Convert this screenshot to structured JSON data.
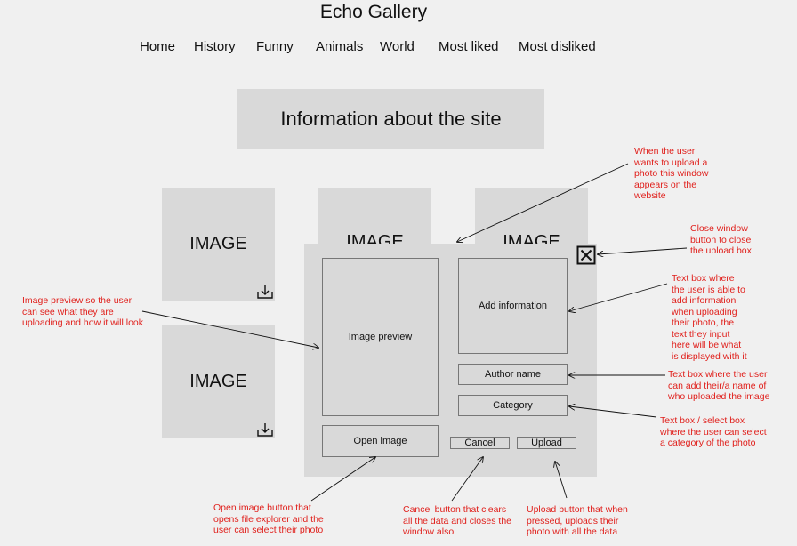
{
  "site": {
    "title": "Echo Gallery"
  },
  "nav": {
    "items": [
      "Home",
      "History",
      "Funny",
      "Animals",
      "World",
      "Most liked",
      "Most disliked"
    ]
  },
  "info": {
    "text": "Information about the site"
  },
  "tiles": {
    "label": "IMAGE"
  },
  "modal": {
    "image_preview": "Image preview",
    "open_image": "Open image",
    "add_information": "Add information",
    "author_name": "Author name",
    "category": "Category",
    "cancel": "Cancel",
    "upload": "Upload"
  },
  "annotations": {
    "window_appears": [
      "When the user",
      "wants to upload a",
      "photo this window",
      "appears on the",
      "website"
    ],
    "close_window": [
      "Close window",
      "button to close",
      "the upload box"
    ],
    "add_info": [
      "Text box where",
      "the user is able to",
      "add information",
      "when uploading",
      "their photo, the",
      "text they input",
      "here will be what",
      "is displayed with it"
    ],
    "author": [
      "Text box where the user",
      "can add their/a name of",
      "who uploaded the image"
    ],
    "category": [
      "Text box / select box",
      "where the user can select",
      "a category of the photo"
    ],
    "preview": [
      "Image preview so the user",
      "can see what they are",
      "uploading and how it will look"
    ],
    "open_image": [
      "Open image button that",
      "opens file explorer and the",
      "user can select their photo"
    ],
    "cancel": [
      "Cancel button that clears",
      "all the data and closes the",
      "window also"
    ],
    "upload": [
      "Upload button that when",
      "pressed, uploads their",
      "photo with all the data"
    ]
  },
  "colors": {
    "annotation": "#e0201c",
    "panel": "#d9d9d9",
    "background": "#f0f0f0"
  }
}
